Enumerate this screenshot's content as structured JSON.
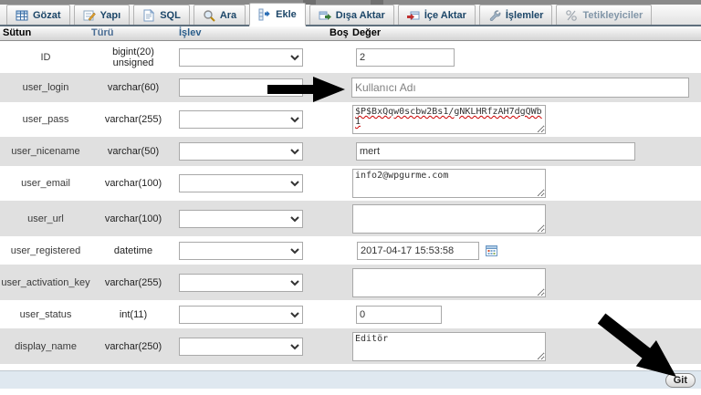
{
  "tabs": [
    {
      "label": "Gözat",
      "icon": "browse-table-icon"
    },
    {
      "label": "Yapı",
      "icon": "structure-icon"
    },
    {
      "label": "SQL",
      "icon": "sql-page-icon"
    },
    {
      "label": "Ara",
      "icon": "search-icon"
    },
    {
      "label": "Ekle",
      "icon": "insert-row-icon",
      "active": true
    },
    {
      "label": "Dışa Aktar",
      "icon": "export-icon"
    },
    {
      "label": "İçe Aktar",
      "icon": "import-icon"
    },
    {
      "label": "İşlemler",
      "icon": "operations-wrench-icon"
    },
    {
      "label": "Tetikleyiciler",
      "icon": "triggers-icon",
      "disabled": true
    }
  ],
  "table_headers": {
    "column": "Sütun",
    "type": "Türü",
    "function": "İşlev",
    "null": "Boş",
    "value": "Değer"
  },
  "rows": [
    {
      "column": "ID",
      "type": "bigint(20) unsigned",
      "value": "2"
    },
    {
      "column": "user_login",
      "type": "varchar(60)",
      "value": "Kullanıcı Adı"
    },
    {
      "column": "user_pass",
      "type": "varchar(255)",
      "value": "$P$BxQqw0scbw2Bs1/gNKLHRfzAH7dgQWb1"
    },
    {
      "column": "user_nicename",
      "type": "varchar(50)",
      "value": "mert"
    },
    {
      "column": "user_email",
      "type": "varchar(100)",
      "value": "info2@wpgurme.com"
    },
    {
      "column": "user_url",
      "type": "varchar(100)",
      "value": ""
    },
    {
      "column": "user_registered",
      "type": "datetime",
      "value": "2017-04-17 15:53:58"
    },
    {
      "column": "user_activation_key",
      "type": "varchar(255)",
      "value": ""
    },
    {
      "column": "user_status",
      "type": "int(11)",
      "value": "0"
    },
    {
      "column": "display_name",
      "type": "varchar(250)",
      "value": "Editör"
    }
  ],
  "footer": {
    "go_label": "Git"
  },
  "colors": {
    "tab_text": "#1c4668",
    "row_shade": "#e0e0e0",
    "footer_bg": "#dfe8f0",
    "arrow": "#000000"
  }
}
